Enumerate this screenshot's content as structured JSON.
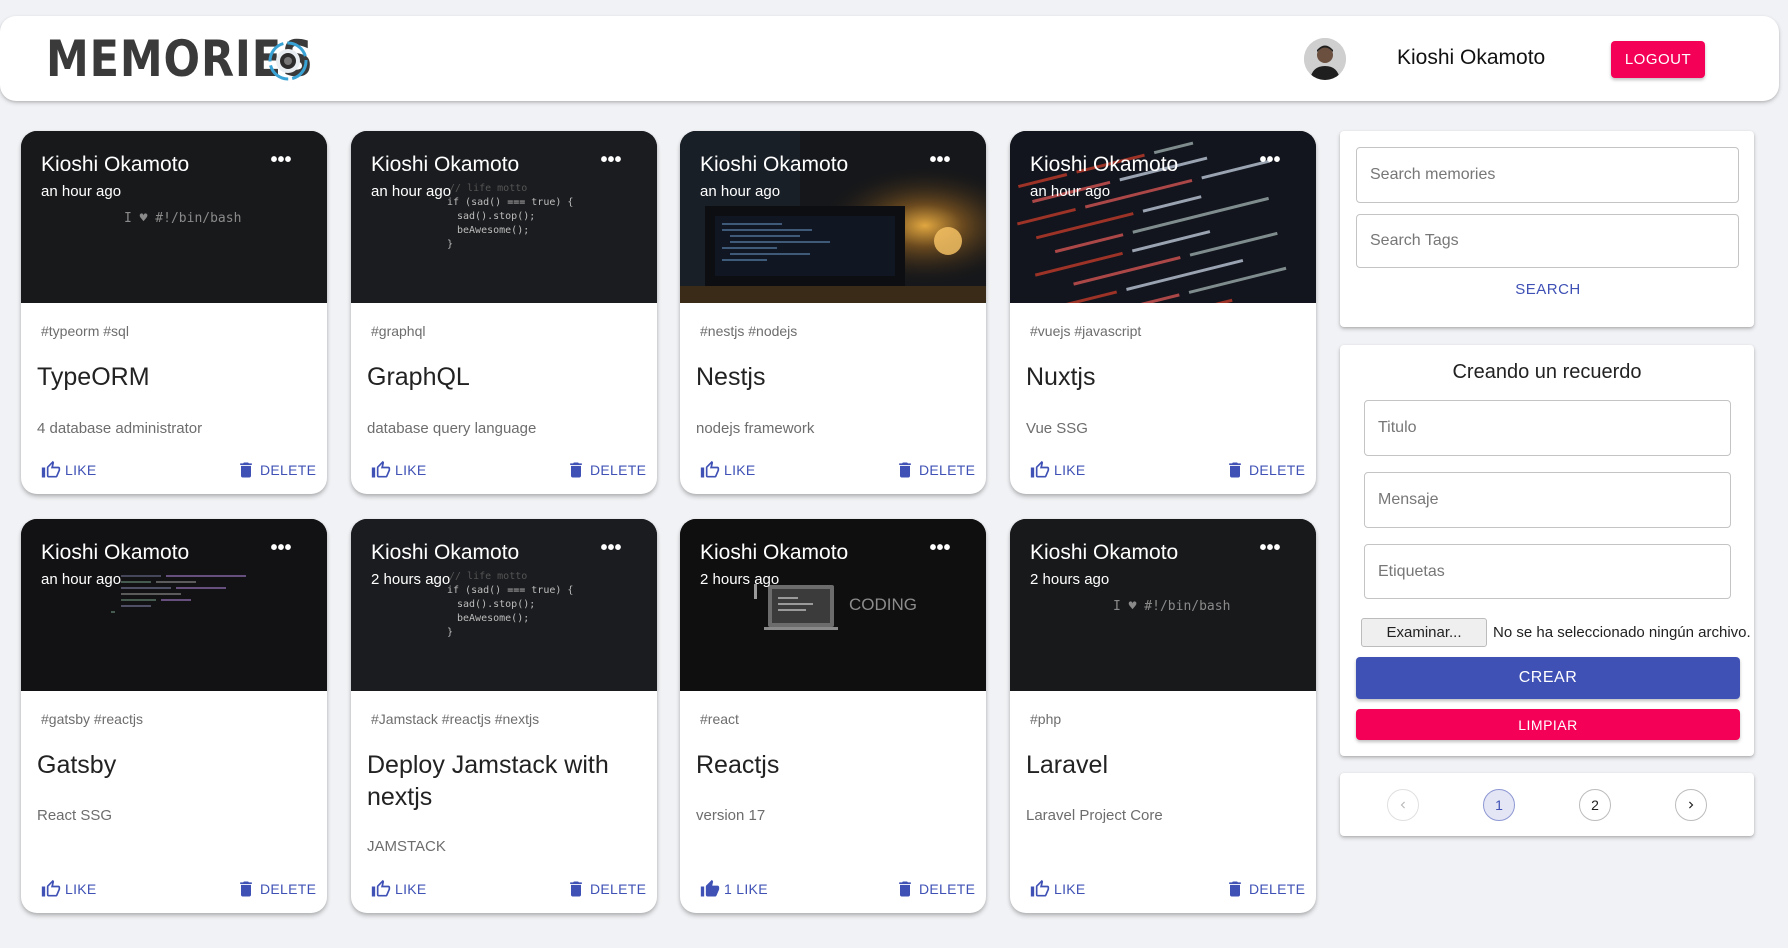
{
  "header": {
    "brand": "MEMORIES",
    "user_name": "Kioshi Okamoto",
    "logout_label": "LOGOUT"
  },
  "colors": {
    "primary": "#3f51b5",
    "secondary": "#f50057",
    "background": "#f1f2f5"
  },
  "cards": [
    {
      "author": "Kioshi Okamoto",
      "time": "an hour ago",
      "tags": "#typeorm #sql",
      "title": "TypeORM",
      "message": "4 database administrator",
      "like_label": "LIKE",
      "delete_label": "DELETE",
      "image_text": "I ♥ #!/bin/bash"
    },
    {
      "author": "Kioshi Okamoto",
      "time": "an hour ago",
      "tags": "#graphql",
      "title": "GraphQL",
      "message": "database query language",
      "like_label": "LIKE",
      "delete_label": "DELETE",
      "image_text": "// life motto"
    },
    {
      "author": "Kioshi Okamoto",
      "time": "an hour ago",
      "tags": "#nestjs #nodejs",
      "title": "Nestjs",
      "message": "nodejs framework",
      "like_label": "LIKE",
      "delete_label": "DELETE"
    },
    {
      "author": "Kioshi Okamoto",
      "time": "an hour ago",
      "tags": "#vuejs #javascript",
      "title": "Nuxtjs",
      "message": "Vue SSG",
      "like_label": "LIKE",
      "delete_label": "DELETE"
    },
    {
      "author": "Kioshi Okamoto",
      "time": "an hour ago",
      "tags": "#gatsby #reactjs",
      "title": "Gatsby",
      "message": "React SSG",
      "like_label": "LIKE",
      "delete_label": "DELETE"
    },
    {
      "author": "Kioshi Okamoto",
      "time": "2 hours ago",
      "tags": "#Jamstack #reactjs #nextjs",
      "title": "Deploy Jamstack with nextjs",
      "message": "JAMSTACK",
      "like_label": "LIKE",
      "delete_label": "DELETE",
      "image_text": "// life motto"
    },
    {
      "author": "Kioshi Okamoto",
      "time": "2 hours ago",
      "tags": "#react",
      "title": "Reactjs",
      "message": "version 17",
      "like_label": "1 LIKE",
      "delete_label": "DELETE",
      "image_text": "CODING"
    },
    {
      "author": "Kioshi Okamoto",
      "time": "2 hours ago",
      "tags": "#php",
      "title": "Laravel",
      "message": "Laravel Project Core",
      "like_label": "LIKE",
      "delete_label": "DELETE",
      "image_text": "I ♥ #!/bin/bash"
    }
  ],
  "search": {
    "memories_placeholder": "Search memories",
    "tags_placeholder": "Search Tags",
    "button_label": "SEARCH"
  },
  "form": {
    "title": "Creando un recuerdo",
    "titulo_placeholder": "Titulo",
    "mensaje_placeholder": "Mensaje",
    "etiquetas_placeholder": "Etiquetas",
    "file_button_label": "Examinar...",
    "file_status": "No se ha seleccionado ningún archivo.",
    "submit_label": "CREAR",
    "clear_label": "LIMPIAR"
  },
  "pagination": {
    "prev_icon": "chevron-left-icon",
    "pages": [
      "1",
      "2"
    ],
    "current_page": "1",
    "next_icon": "chevron-right-icon"
  }
}
